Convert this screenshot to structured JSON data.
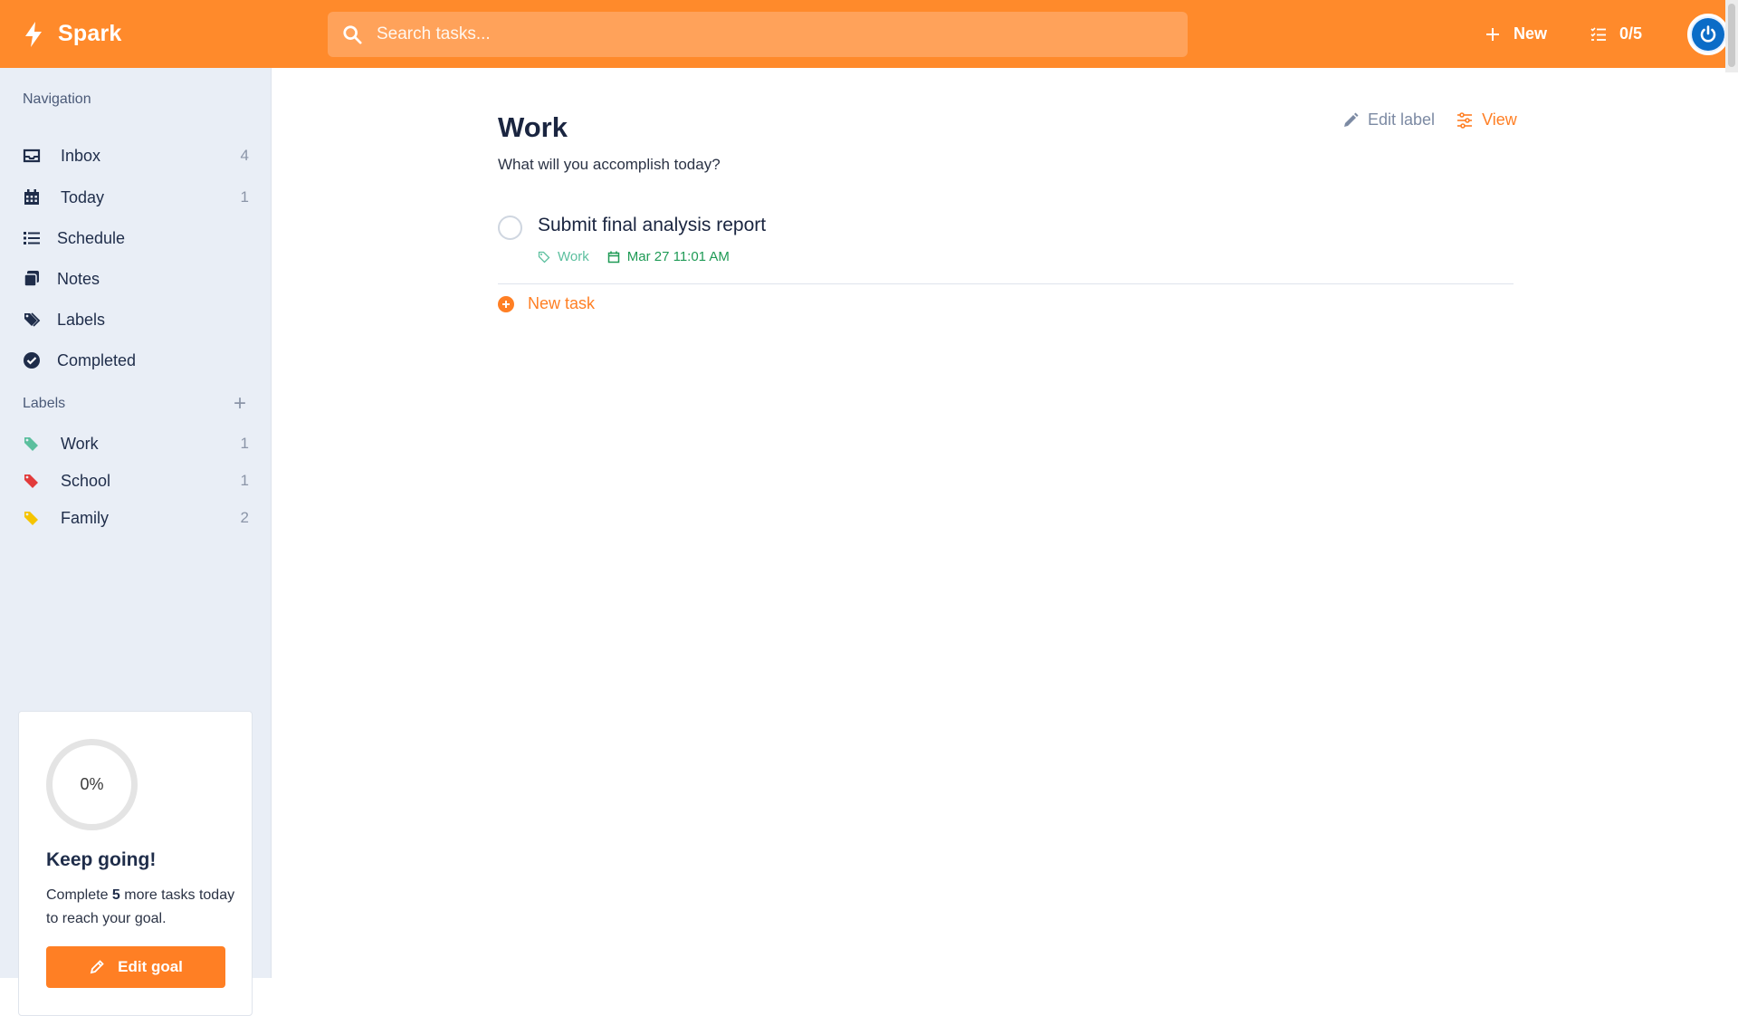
{
  "colors": {
    "accent": "#ff8a2b",
    "work": "#5bbf9e",
    "school": "#e23b3b",
    "family": "#f5c400",
    "date": "#1e9a55"
  },
  "header": {
    "brand": "Spark",
    "search_placeholder": "Search tasks...",
    "new_label": "New",
    "progress_label": "0/5"
  },
  "sidebar": {
    "nav_title": "Navigation",
    "nav": [
      {
        "label": "Inbox",
        "count": "4",
        "icon": "inbox-icon"
      },
      {
        "label": "Today",
        "count": "1",
        "icon": "calendar-icon"
      },
      {
        "label": "Schedule",
        "icon": "list-icon"
      },
      {
        "label": "Notes",
        "icon": "notes-icon"
      },
      {
        "label": "Labels",
        "icon": "tags-icon"
      },
      {
        "label": "Completed",
        "icon": "check-circle-icon"
      }
    ],
    "labels_title": "Labels",
    "labels": [
      {
        "label": "Work",
        "count": "1",
        "color": "#5bbf9e"
      },
      {
        "label": "School",
        "count": "1",
        "color": "#e23b3b"
      },
      {
        "label": "Family",
        "count": "2",
        "color": "#f5c400"
      }
    ],
    "goal": {
      "percent": "0%",
      "title": "Keep going!",
      "text_before": "Complete ",
      "remaining": "5",
      "text_after": " more tasks today to reach your goal.",
      "button": "Edit goal"
    }
  },
  "main": {
    "title": "Work",
    "subtitle": "What will you accomplish today?",
    "edit_label": "Edit label",
    "view_label": "View",
    "tasks": [
      {
        "title": "Submit final analysis report",
        "label": "Work",
        "date": "Mar 27 11:01 AM"
      }
    ],
    "new_task_label": "New task"
  }
}
